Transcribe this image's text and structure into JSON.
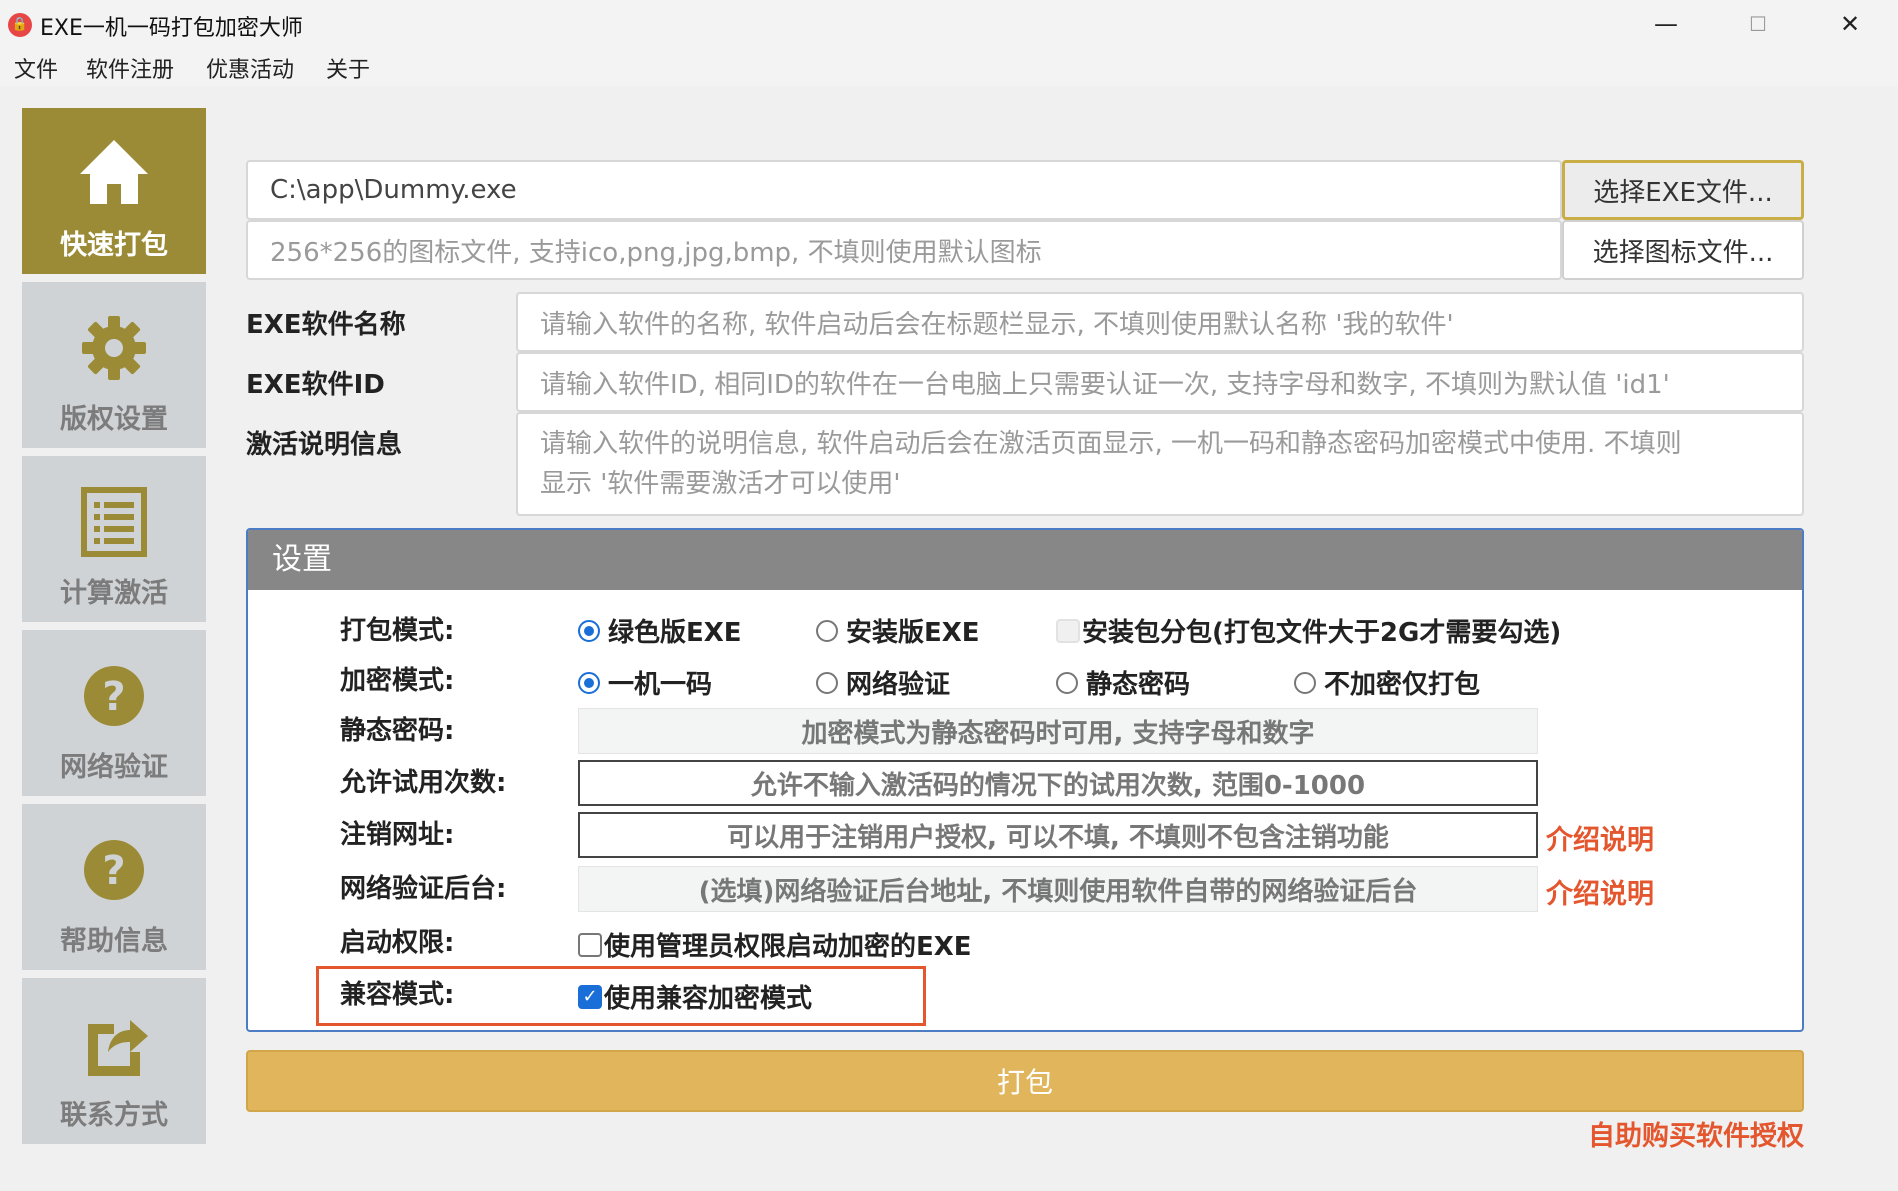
{
  "window": {
    "title": "EXE一机一码打包加密大师",
    "controls": {
      "minimize": "—",
      "maximize": "☐",
      "close": "✕"
    }
  },
  "menu": [
    "文件",
    "软件注册",
    "优惠活动",
    "关于"
  ],
  "sidebar": {
    "items": [
      {
        "label": "快速打包",
        "icon": "home-icon",
        "active": true
      },
      {
        "label": "版权设置",
        "icon": "gear-icon",
        "active": false
      },
      {
        "label": "计算激活",
        "icon": "list-icon",
        "active": false
      },
      {
        "label": "网络验证",
        "icon": "question-icon",
        "active": false
      },
      {
        "label": "帮助信息",
        "icon": "question-icon",
        "active": false
      },
      {
        "label": "联系方式",
        "icon": "share-icon",
        "active": false
      }
    ]
  },
  "file": {
    "exe_path": "C:\\app\\Dummy.exe",
    "select_exe": "选择EXE文件...",
    "icon_placeholder": "256*256的图标文件, 支持ico,png,jpg,bmp, 不填则使用默认图标",
    "select_icon": "选择图标文件..."
  },
  "fields": {
    "name_label": "EXE软件名称",
    "name_placeholder": "请输入软件的名称, 软件启动后会在标题栏显示, 不填则使用默认名称 '我的软件'",
    "id_label": "EXE软件ID",
    "id_placeholder": "请输入软件ID, 相同ID的软件在一台电脑上只需要认证一次, 支持字母和数字, 不填则为默认值 'id1'",
    "desc_label": "激活说明信息",
    "desc_placeholder_1": "请输入软件的说明信息, 软件启动后会在激活页面显示, 一机一码和静态密码加密模式中使用. 不填则",
    "desc_placeholder_2": "显示 '软件需要激活才可以使用'"
  },
  "settings": {
    "title": "设置",
    "pack_mode": {
      "label": "打包模式:",
      "options": [
        "绿色版EXE",
        "安装版EXE"
      ],
      "split_label": "安装包分包(打包文件大于2G才需要勾选)",
      "selected": 0
    },
    "enc_mode": {
      "label": "加密模式:",
      "options": [
        "一机一码",
        "网络验证",
        "静态密码",
        "不加密仅打包"
      ],
      "selected": 0
    },
    "static_pw": {
      "label": "静态密码:",
      "placeholder": "加密模式为静态密码时可用, 支持字母和数字"
    },
    "trial": {
      "label": "允许试用次数:",
      "placeholder": "允许不输入激活码的情况下的试用次数, 范围0-1000"
    },
    "logout": {
      "label": "注销网址:",
      "placeholder": "可以用于注销用户授权, 可以不填, 不填则不包含注销功能",
      "link": "介绍说明"
    },
    "backend": {
      "label": "网络验证后台:",
      "placeholder": "(选填)网络验证后台地址, 不填则使用软件自带的网络验证后台",
      "link": "介绍说明"
    },
    "privilege": {
      "label": "启动权限:",
      "checkbox": "使用管理员权限启动加密的EXE",
      "checked": false
    },
    "compat": {
      "label": "兼容模式:",
      "checkbox": "使用兼容加密模式",
      "checked": true
    }
  },
  "actions": {
    "pack": "打包",
    "buy": "自助购买软件授权"
  },
  "colors": {
    "accent": "#9c8b36",
    "pack": "#e0b55b",
    "link": "#e4572e",
    "header": "#878787"
  }
}
